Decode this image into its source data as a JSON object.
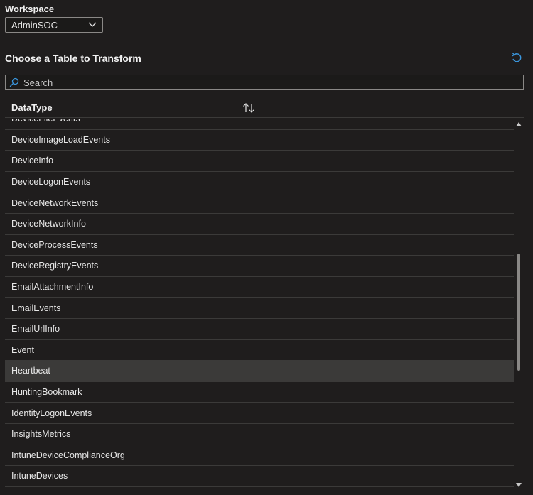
{
  "workspace": {
    "label": "Workspace",
    "selected": "AdminSOC"
  },
  "section": {
    "title": "Choose a Table to Transform"
  },
  "search": {
    "placeholder": "Search",
    "value": ""
  },
  "table": {
    "column_header": "DataType",
    "rows": [
      "DeviceFileEvents",
      "DeviceImageLoadEvents",
      "DeviceInfo",
      "DeviceLogonEvents",
      "DeviceNetworkEvents",
      "DeviceNetworkInfo",
      "DeviceProcessEvents",
      "DeviceRegistryEvents",
      "EmailAttachmentInfo",
      "EmailEvents",
      "EmailUrlInfo",
      "Event",
      "Heartbeat",
      "HuntingBookmark",
      "IdentityLogonEvents",
      "InsightsMetrics",
      "IntuneDeviceComplianceOrg",
      "IntuneDevices"
    ],
    "selected_row": "Heartbeat"
  },
  "icons": {
    "workspace_dropdown": "chevron-down-icon",
    "refresh": "refresh-icon",
    "search": "search-icon",
    "sort": "sort-icon"
  },
  "colors": {
    "background": "#1f1d1d",
    "accent": "#3a96dd",
    "selected_row": "#3b3a39"
  }
}
